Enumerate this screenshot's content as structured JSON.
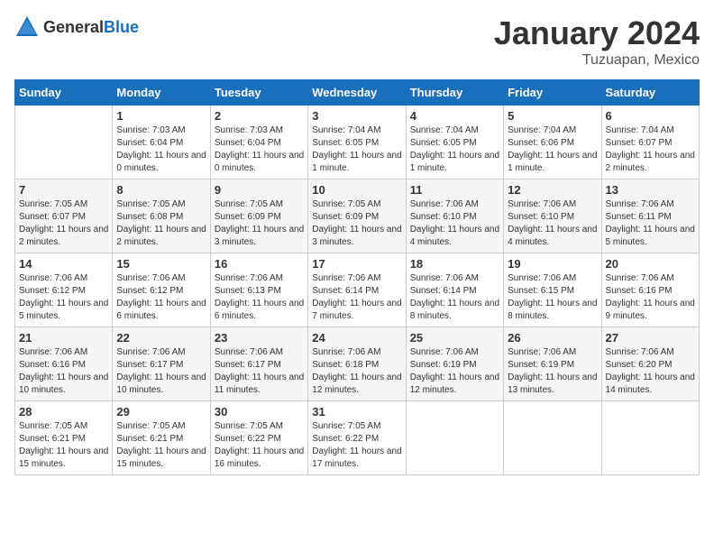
{
  "header": {
    "logo_general": "General",
    "logo_blue": "Blue",
    "month_title": "January 2024",
    "location": "Tuzuapan, Mexico"
  },
  "days_of_week": [
    "Sunday",
    "Monday",
    "Tuesday",
    "Wednesday",
    "Thursday",
    "Friday",
    "Saturday"
  ],
  "weeks": [
    [
      {
        "day": "",
        "sunrise": "",
        "sunset": "",
        "daylight": ""
      },
      {
        "day": "1",
        "sunrise": "Sunrise: 7:03 AM",
        "sunset": "Sunset: 6:04 PM",
        "daylight": "Daylight: 11 hours and 0 minutes."
      },
      {
        "day": "2",
        "sunrise": "Sunrise: 7:03 AM",
        "sunset": "Sunset: 6:04 PM",
        "daylight": "Daylight: 11 hours and 0 minutes."
      },
      {
        "day": "3",
        "sunrise": "Sunrise: 7:04 AM",
        "sunset": "Sunset: 6:05 PM",
        "daylight": "Daylight: 11 hours and 1 minute."
      },
      {
        "day": "4",
        "sunrise": "Sunrise: 7:04 AM",
        "sunset": "Sunset: 6:05 PM",
        "daylight": "Daylight: 11 hours and 1 minute."
      },
      {
        "day": "5",
        "sunrise": "Sunrise: 7:04 AM",
        "sunset": "Sunset: 6:06 PM",
        "daylight": "Daylight: 11 hours and 1 minute."
      },
      {
        "day": "6",
        "sunrise": "Sunrise: 7:04 AM",
        "sunset": "Sunset: 6:07 PM",
        "daylight": "Daylight: 11 hours and 2 minutes."
      }
    ],
    [
      {
        "day": "7",
        "sunrise": "Sunrise: 7:05 AM",
        "sunset": "Sunset: 6:07 PM",
        "daylight": "Daylight: 11 hours and 2 minutes."
      },
      {
        "day": "8",
        "sunrise": "Sunrise: 7:05 AM",
        "sunset": "Sunset: 6:08 PM",
        "daylight": "Daylight: 11 hours and 2 minutes."
      },
      {
        "day": "9",
        "sunrise": "Sunrise: 7:05 AM",
        "sunset": "Sunset: 6:09 PM",
        "daylight": "Daylight: 11 hours and 3 minutes."
      },
      {
        "day": "10",
        "sunrise": "Sunrise: 7:05 AM",
        "sunset": "Sunset: 6:09 PM",
        "daylight": "Daylight: 11 hours and 3 minutes."
      },
      {
        "day": "11",
        "sunrise": "Sunrise: 7:06 AM",
        "sunset": "Sunset: 6:10 PM",
        "daylight": "Daylight: 11 hours and 4 minutes."
      },
      {
        "day": "12",
        "sunrise": "Sunrise: 7:06 AM",
        "sunset": "Sunset: 6:10 PM",
        "daylight": "Daylight: 11 hours and 4 minutes."
      },
      {
        "day": "13",
        "sunrise": "Sunrise: 7:06 AM",
        "sunset": "Sunset: 6:11 PM",
        "daylight": "Daylight: 11 hours and 5 minutes."
      }
    ],
    [
      {
        "day": "14",
        "sunrise": "Sunrise: 7:06 AM",
        "sunset": "Sunset: 6:12 PM",
        "daylight": "Daylight: 11 hours and 5 minutes."
      },
      {
        "day": "15",
        "sunrise": "Sunrise: 7:06 AM",
        "sunset": "Sunset: 6:12 PM",
        "daylight": "Daylight: 11 hours and 6 minutes."
      },
      {
        "day": "16",
        "sunrise": "Sunrise: 7:06 AM",
        "sunset": "Sunset: 6:13 PM",
        "daylight": "Daylight: 11 hours and 6 minutes."
      },
      {
        "day": "17",
        "sunrise": "Sunrise: 7:06 AM",
        "sunset": "Sunset: 6:14 PM",
        "daylight": "Daylight: 11 hours and 7 minutes."
      },
      {
        "day": "18",
        "sunrise": "Sunrise: 7:06 AM",
        "sunset": "Sunset: 6:14 PM",
        "daylight": "Daylight: 11 hours and 8 minutes."
      },
      {
        "day": "19",
        "sunrise": "Sunrise: 7:06 AM",
        "sunset": "Sunset: 6:15 PM",
        "daylight": "Daylight: 11 hours and 8 minutes."
      },
      {
        "day": "20",
        "sunrise": "Sunrise: 7:06 AM",
        "sunset": "Sunset: 6:16 PM",
        "daylight": "Daylight: 11 hours and 9 minutes."
      }
    ],
    [
      {
        "day": "21",
        "sunrise": "Sunrise: 7:06 AM",
        "sunset": "Sunset: 6:16 PM",
        "daylight": "Daylight: 11 hours and 10 minutes."
      },
      {
        "day": "22",
        "sunrise": "Sunrise: 7:06 AM",
        "sunset": "Sunset: 6:17 PM",
        "daylight": "Daylight: 11 hours and 10 minutes."
      },
      {
        "day": "23",
        "sunrise": "Sunrise: 7:06 AM",
        "sunset": "Sunset: 6:17 PM",
        "daylight": "Daylight: 11 hours and 11 minutes."
      },
      {
        "day": "24",
        "sunrise": "Sunrise: 7:06 AM",
        "sunset": "Sunset: 6:18 PM",
        "daylight": "Daylight: 11 hours and 12 minutes."
      },
      {
        "day": "25",
        "sunrise": "Sunrise: 7:06 AM",
        "sunset": "Sunset: 6:19 PM",
        "daylight": "Daylight: 11 hours and 12 minutes."
      },
      {
        "day": "26",
        "sunrise": "Sunrise: 7:06 AM",
        "sunset": "Sunset: 6:19 PM",
        "daylight": "Daylight: 11 hours and 13 minutes."
      },
      {
        "day": "27",
        "sunrise": "Sunrise: 7:06 AM",
        "sunset": "Sunset: 6:20 PM",
        "daylight": "Daylight: 11 hours and 14 minutes."
      }
    ],
    [
      {
        "day": "28",
        "sunrise": "Sunrise: 7:05 AM",
        "sunset": "Sunset: 6:21 PM",
        "daylight": "Daylight: 11 hours and 15 minutes."
      },
      {
        "day": "29",
        "sunrise": "Sunrise: 7:05 AM",
        "sunset": "Sunset: 6:21 PM",
        "daylight": "Daylight: 11 hours and 15 minutes."
      },
      {
        "day": "30",
        "sunrise": "Sunrise: 7:05 AM",
        "sunset": "Sunset: 6:22 PM",
        "daylight": "Daylight: 11 hours and 16 minutes."
      },
      {
        "day": "31",
        "sunrise": "Sunrise: 7:05 AM",
        "sunset": "Sunset: 6:22 PM",
        "daylight": "Daylight: 11 hours and 17 minutes."
      },
      {
        "day": "",
        "sunrise": "",
        "sunset": "",
        "daylight": ""
      },
      {
        "day": "",
        "sunrise": "",
        "sunset": "",
        "daylight": ""
      },
      {
        "day": "",
        "sunrise": "",
        "sunset": "",
        "daylight": ""
      }
    ]
  ]
}
